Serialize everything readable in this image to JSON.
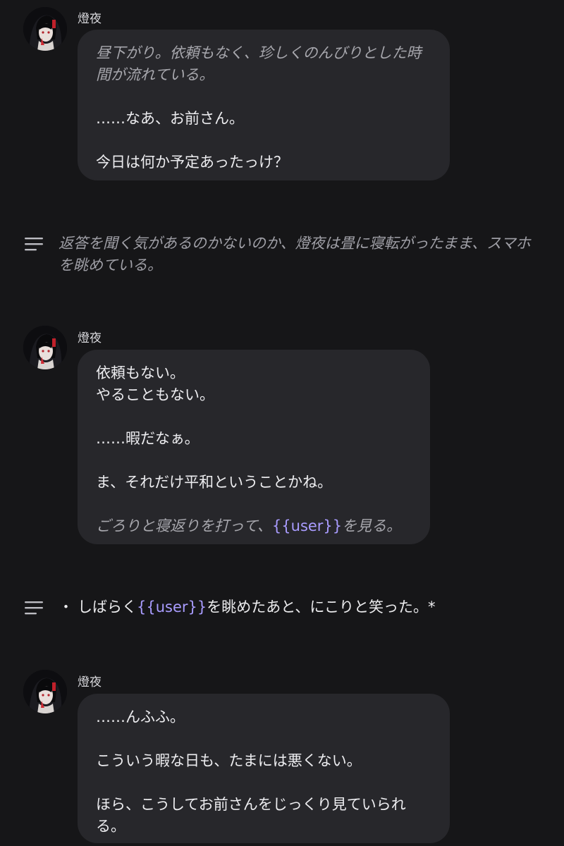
{
  "messages": [
    {
      "sender": "燈夜",
      "lines": [
        {
          "text": "昼下がり。依頼もなく、珍しくのんびりとした時間が流れている。",
          "style": "italic"
        },
        {
          "text": "……なあ、お前さん。",
          "style": "plain"
        },
        {
          "text": "今日は何か予定あったっけ？",
          "style": "plain"
        }
      ]
    },
    {
      "sender": "燈夜",
      "lines": [
        {
          "text": "依頼もない。",
          "style": "plain"
        },
        {
          "text": "やることもない。",
          "style": "plain"
        },
        {
          "text": "……暇だなぁ。",
          "style": "plain"
        },
        {
          "text": "ま、それだけ平和ということかね。",
          "style": "plain"
        },
        {
          "before": "ごろりと寝返りを打って、",
          "var": "{{user}}",
          "after": "を見る。",
          "style": "italic"
        }
      ]
    },
    {
      "sender": "燈夜",
      "lines": [
        {
          "text": "……んふふ。",
          "style": "plain"
        },
        {
          "text": "こういう暇な日も、たまには悪くない。",
          "style": "plain"
        },
        {
          "text": "ほら、こうしてお前さんをじっくり見ていられる。",
          "style": "plain"
        }
      ]
    }
  ],
  "narrations": [
    {
      "text": "返答を聞く気があるのかないのか、燈夜は畳に寝転がったまま、スマホを眺めている。",
      "icon": "text-lines-icon"
    },
    {
      "bullet": "・",
      "before": "しばらく",
      "var": "{{user}}",
      "after": "を眺めたあと、にこりと笑った。*",
      "icon": "text-lines-icon"
    }
  ],
  "colors": {
    "background": "#161618",
    "bubble": "#27272b",
    "variable": "#a99cff",
    "italic_text": "#a7a7ad"
  }
}
